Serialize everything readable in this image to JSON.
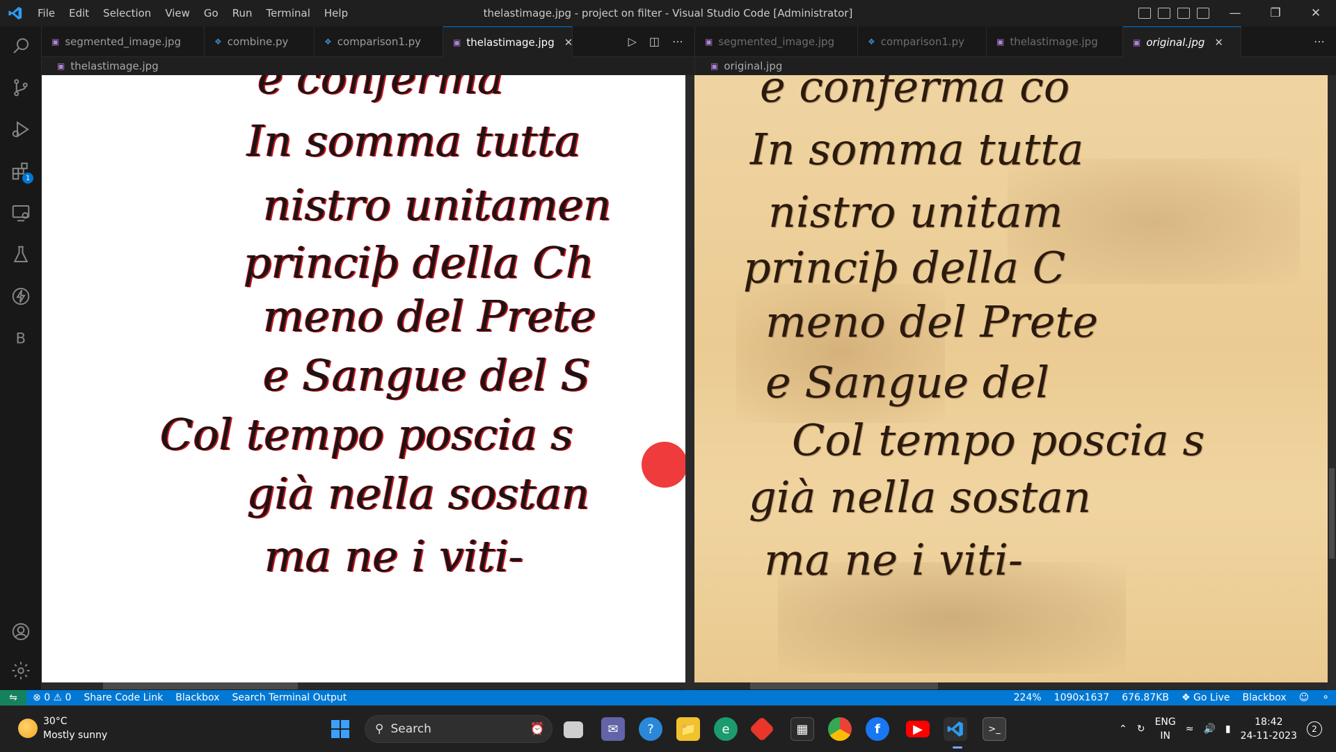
{
  "titlebar": {
    "menu": [
      "File",
      "Edit",
      "Selection",
      "View",
      "Go",
      "Run",
      "Terminal",
      "Help"
    ],
    "title": "thelastimage.jpg - project on filter - Visual Studio Code [Administrator]"
  },
  "activity_badge": "1",
  "left_group": {
    "tabs": [
      {
        "label": "segmented_image.jpg",
        "icon": "image-icon"
      },
      {
        "label": "combine.py",
        "icon": "python-icon"
      },
      {
        "label": "comparison1.py",
        "icon": "python-icon"
      },
      {
        "label": "thelastimage.jpg",
        "icon": "image-icon",
        "active": true
      }
    ],
    "breadcrumb": "thelastimage.jpg",
    "lines": [
      "e conferma",
      "In somma tutta",
      "nistro unitamen",
      "princiþ della Ch",
      "meno del Prete",
      "e Sangue del S",
      "Col tempo poscia s",
      "già nella sostan",
      "ma ne i viti-"
    ]
  },
  "right_group": {
    "tabs": [
      {
        "label": "segmented_image.jpg",
        "icon": "image-icon"
      },
      {
        "label": "comparison1.py",
        "icon": "python-icon"
      },
      {
        "label": "thelastimage.jpg",
        "icon": "image-icon"
      },
      {
        "label": "original.jpg",
        "icon": "image-icon",
        "active": true
      }
    ],
    "breadcrumb": "original.jpg",
    "lines": [
      "e conferma co",
      "In somma tutta",
      "nistro unitam",
      "princiþ della C",
      "meno del Prete",
      "e Sangue del",
      "Col tempo poscia s",
      "già nella sostan",
      "ma ne i viti-"
    ]
  },
  "statusbar": {
    "errors": "0",
    "warnings": "0",
    "items_left": [
      "Share Code Link",
      "Blackbox",
      "Search Terminal Output"
    ],
    "zoom": "224%",
    "dimensions": "1090x1637",
    "filesize": "676.87KB",
    "golive": "Go Live",
    "blackbox": "Blackbox"
  },
  "taskbar": {
    "weather_temp": "30°C",
    "weather_desc": "Mostly sunny",
    "search": "Search",
    "lang1": "ENG",
    "lang2": "IN",
    "time": "18:42",
    "date": "24-11-2023",
    "notifications": "2"
  },
  "colors": {
    "accent": "#0078d4",
    "status": "#0078d4",
    "ink_red": "#c8141e",
    "ink_dark": "#2b1a0e",
    "parchment": "#efd3a0"
  }
}
